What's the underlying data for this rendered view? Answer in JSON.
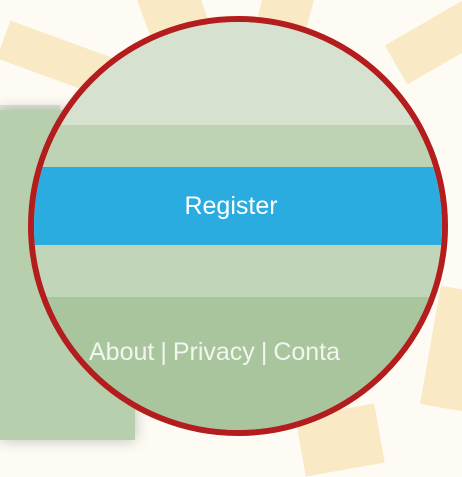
{
  "register_button": {
    "label": "Register"
  },
  "footer": {
    "links": [
      "About",
      "Privacy",
      "Conta"
    ],
    "separator": "|"
  },
  "colors": {
    "magnifier_border": "#b31d1d",
    "register_bg": "#2aace1",
    "footer_bg": "#a9c59e"
  }
}
